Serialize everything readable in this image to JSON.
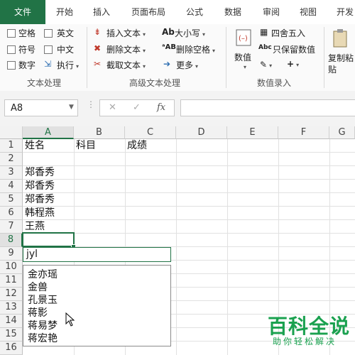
{
  "tabs": [
    {
      "label": "文件",
      "active": true
    },
    {
      "label": "开始",
      "active": false
    },
    {
      "label": "插入",
      "active": false
    },
    {
      "label": "页面布局",
      "active": false
    },
    {
      "label": "公式",
      "active": false
    },
    {
      "label": "数据",
      "active": false
    },
    {
      "label": "审阅",
      "active": false
    },
    {
      "label": "视图",
      "active": false
    },
    {
      "label": "开发",
      "active": false
    }
  ],
  "ribbon": {
    "text_group": {
      "items": [
        "空格",
        "英文",
        "符号",
        "中文",
        "数字",
        "执行"
      ],
      "label": "文本处理"
    },
    "advanced_group": {
      "insert_text": "插入文本",
      "delete_text": "删除文本",
      "extract_text": "截取文本",
      "case": "大小写",
      "delete_space": "删除空格",
      "more": "更多",
      "label": "高级文本处理"
    },
    "numeric_group": {
      "value_button": "数值",
      "round": "四舍五入",
      "keep_value": "只保留数值",
      "label": "数值录入"
    },
    "paste_button": "复制粘贴"
  },
  "formula_bar": {
    "name_box": "A8",
    "formula": ""
  },
  "columns": [
    "A",
    "B",
    "C",
    "D",
    "E",
    "F",
    "G"
  ],
  "rows": [
    "1",
    "2",
    "3",
    "4",
    "5",
    "6",
    "7",
    "8",
    "9",
    "10",
    "11",
    "12",
    "13",
    "14",
    "15",
    "16"
  ],
  "cells": {
    "A1": "姓名",
    "B1": "科目",
    "C1": "成绩",
    "A3": "郑香秀",
    "A4": "郑香秀",
    "A5": "郑香秀",
    "A6": "韩程燕",
    "A7": "王燕"
  },
  "editing_text": "jyl",
  "suggestions": [
    "金亦瑶",
    "金兽",
    "孔景玉",
    "蒋影",
    "蒋易梦",
    "蒋宏艳"
  ],
  "watermark": {
    "title": "百科全说",
    "subtitle": "助你轻松解决"
  }
}
